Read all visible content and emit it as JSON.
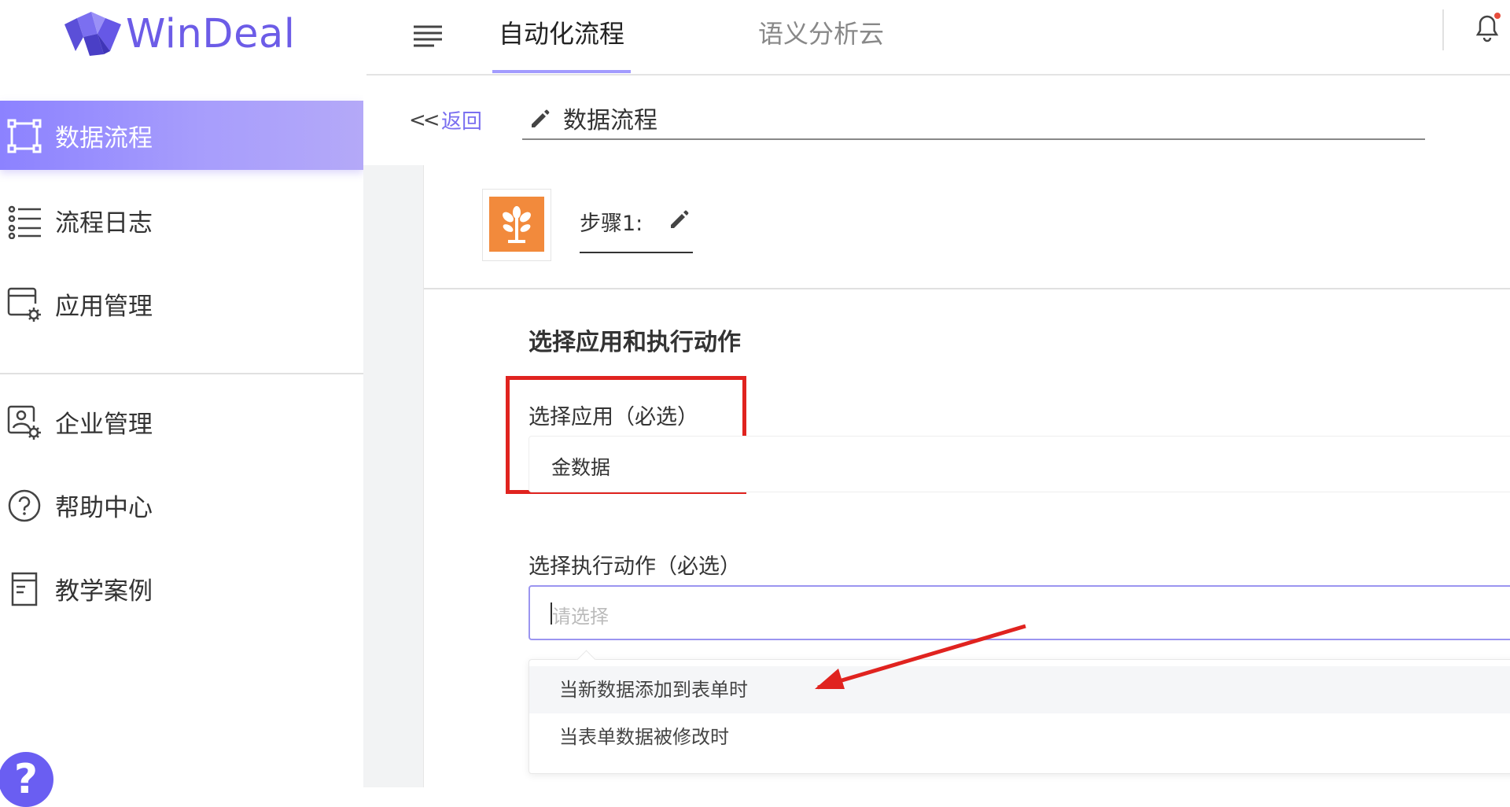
{
  "brand": {
    "name": "WinDeal",
    "color": "#6c5ce7"
  },
  "sidebar": {
    "items": [
      {
        "label": "数据流程",
        "icon": "flow-icon",
        "active": true
      },
      {
        "label": "流程日志",
        "icon": "list-icon",
        "active": false
      },
      {
        "label": "应用管理",
        "icon": "app-settings-icon",
        "active": false
      },
      {
        "label": "企业管理",
        "icon": "enterprise-settings-icon",
        "active": false
      },
      {
        "label": "帮助中心",
        "icon": "help-circle-icon",
        "active": false
      },
      {
        "label": "教学案例",
        "icon": "document-icon",
        "active": false
      }
    ],
    "help_badge": "?"
  },
  "topbar": {
    "tabs": [
      {
        "label": "自动化流程",
        "active": true
      },
      {
        "label": "语义分析云",
        "active": false
      }
    ]
  },
  "breadcrumb": {
    "back_label": "返回",
    "back_arrows": "<<",
    "flow_name": "数据流程"
  },
  "step": {
    "label": "步骤1:"
  },
  "form": {
    "section_title": "选择应用和执行动作",
    "app_label": "选择应用（必选）",
    "app_value": "金数据",
    "action_label": "选择执行动作（必选）",
    "action_placeholder": "请选择",
    "options": [
      {
        "label": "当新数据添加到表单时",
        "hover": true
      },
      {
        "label": "当表单数据被修改时",
        "hover": false
      }
    ]
  },
  "colors": {
    "accent": "#8c82ff",
    "annotation_red": "#e0231f",
    "app_icon_bg": "#f28a3c"
  }
}
